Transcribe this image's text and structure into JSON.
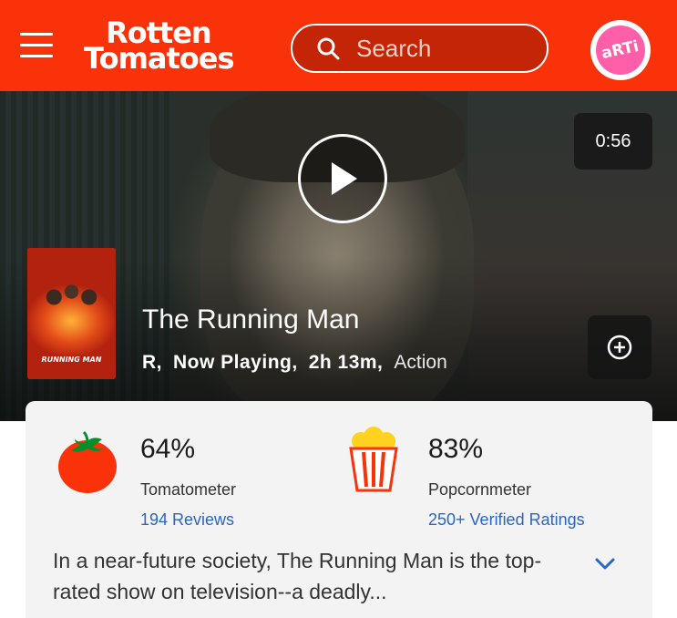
{
  "header": {
    "logo_line1": "Rotten",
    "logo_line2": "Tomatoes",
    "search_placeholder": "Search",
    "avatar_text": "aRTi"
  },
  "hero": {
    "duration": "0:56",
    "poster_title": "RUNNING MAN",
    "title": "The Running Man",
    "rating": "R,",
    "status": "Now Playing,",
    "runtime": "2h 13m,",
    "genre": "Action"
  },
  "scores": {
    "tomatometer": {
      "value": "64%",
      "label": "Tomatometer",
      "link": "194 Reviews"
    },
    "popcornmeter": {
      "value": "83%",
      "label": "Popcornmeter",
      "link": "250+ Verified Ratings"
    }
  },
  "synopsis": "In a near-future society, The Running Man is the top-rated show on television--a deadly...",
  "colors": {
    "brand": "#fa320a",
    "link": "#2a66c4"
  }
}
